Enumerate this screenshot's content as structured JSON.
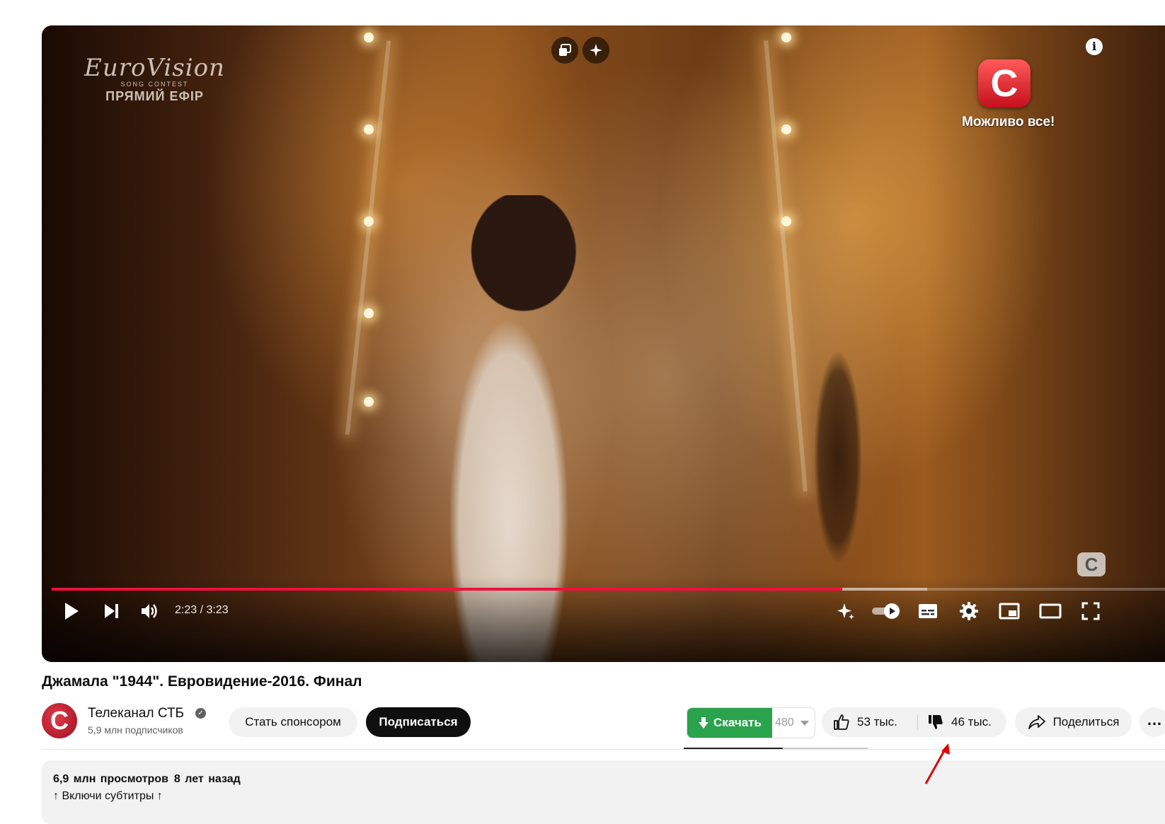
{
  "player": {
    "overlay": {
      "eurovision_logo_word": "EuroVision",
      "eurovision_logo_sub": "SONG CONTEST",
      "eurovision_live": "ПРЯМИЙ ЕФІР",
      "stb_badge": "С",
      "stb_tagline": "Можливо все!",
      "corner_watermark": "С",
      "info_icon": "info-icon"
    },
    "progress_fraction_played": 0.704,
    "progress_fraction_buffered": 0.78,
    "time_display": "2:23 / 3:23",
    "controls": [
      "play-icon",
      "next-icon",
      "volume-icon",
      "autoplay-toggle",
      "subtitles-icon",
      "settings-icon",
      "miniplayer-icon",
      "theater-icon",
      "fullscreen-icon"
    ],
    "accent_color": "#f00f3c"
  },
  "video": {
    "title": "Джамала \"1944\". Евровидение-2016. Финал"
  },
  "channel": {
    "avatar_letter": "С",
    "name": "Телеканал СТБ",
    "verified_mark": "✓",
    "subscribers": "5,9 млн подписчиков",
    "sponsor_label": "Стать спонсором",
    "subscribe_label": "Подписаться"
  },
  "actions": {
    "download_label": "Скачать",
    "download_quality": "480",
    "download_color": "#2ba24c",
    "likes": "53 тыс.",
    "dislikes": "46 тыс.",
    "share_label": "Поделиться",
    "more_label": "…"
  },
  "description": {
    "views": "6,9 млн просмотров",
    "date": "8 лет назад",
    "line1": "↑ Включи субтитры ↑"
  }
}
